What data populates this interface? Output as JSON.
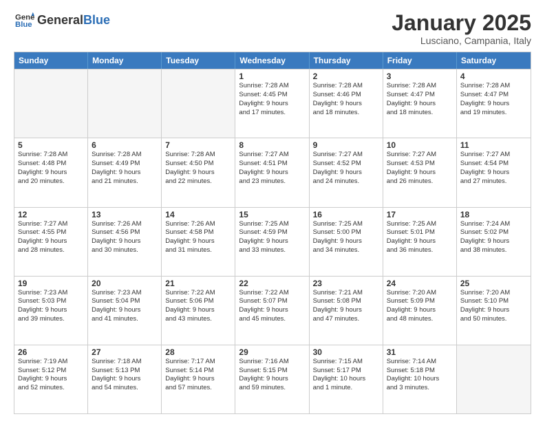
{
  "header": {
    "logo_general": "General",
    "logo_blue": "Blue",
    "month_title": "January 2025",
    "location": "Lusciano, Campania, Italy"
  },
  "weekdays": [
    "Sunday",
    "Monday",
    "Tuesday",
    "Wednesday",
    "Thursday",
    "Friday",
    "Saturday"
  ],
  "weeks": [
    [
      {
        "day": "",
        "info": ""
      },
      {
        "day": "",
        "info": ""
      },
      {
        "day": "",
        "info": ""
      },
      {
        "day": "1",
        "info": "Sunrise: 7:28 AM\nSunset: 4:45 PM\nDaylight: 9 hours\nand 17 minutes."
      },
      {
        "day": "2",
        "info": "Sunrise: 7:28 AM\nSunset: 4:46 PM\nDaylight: 9 hours\nand 18 minutes."
      },
      {
        "day": "3",
        "info": "Sunrise: 7:28 AM\nSunset: 4:47 PM\nDaylight: 9 hours\nand 18 minutes."
      },
      {
        "day": "4",
        "info": "Sunrise: 7:28 AM\nSunset: 4:47 PM\nDaylight: 9 hours\nand 19 minutes."
      }
    ],
    [
      {
        "day": "5",
        "info": "Sunrise: 7:28 AM\nSunset: 4:48 PM\nDaylight: 9 hours\nand 20 minutes."
      },
      {
        "day": "6",
        "info": "Sunrise: 7:28 AM\nSunset: 4:49 PM\nDaylight: 9 hours\nand 21 minutes."
      },
      {
        "day": "7",
        "info": "Sunrise: 7:28 AM\nSunset: 4:50 PM\nDaylight: 9 hours\nand 22 minutes."
      },
      {
        "day": "8",
        "info": "Sunrise: 7:27 AM\nSunset: 4:51 PM\nDaylight: 9 hours\nand 23 minutes."
      },
      {
        "day": "9",
        "info": "Sunrise: 7:27 AM\nSunset: 4:52 PM\nDaylight: 9 hours\nand 24 minutes."
      },
      {
        "day": "10",
        "info": "Sunrise: 7:27 AM\nSunset: 4:53 PM\nDaylight: 9 hours\nand 26 minutes."
      },
      {
        "day": "11",
        "info": "Sunrise: 7:27 AM\nSunset: 4:54 PM\nDaylight: 9 hours\nand 27 minutes."
      }
    ],
    [
      {
        "day": "12",
        "info": "Sunrise: 7:27 AM\nSunset: 4:55 PM\nDaylight: 9 hours\nand 28 minutes."
      },
      {
        "day": "13",
        "info": "Sunrise: 7:26 AM\nSunset: 4:56 PM\nDaylight: 9 hours\nand 30 minutes."
      },
      {
        "day": "14",
        "info": "Sunrise: 7:26 AM\nSunset: 4:58 PM\nDaylight: 9 hours\nand 31 minutes."
      },
      {
        "day": "15",
        "info": "Sunrise: 7:25 AM\nSunset: 4:59 PM\nDaylight: 9 hours\nand 33 minutes."
      },
      {
        "day": "16",
        "info": "Sunrise: 7:25 AM\nSunset: 5:00 PM\nDaylight: 9 hours\nand 34 minutes."
      },
      {
        "day": "17",
        "info": "Sunrise: 7:25 AM\nSunset: 5:01 PM\nDaylight: 9 hours\nand 36 minutes."
      },
      {
        "day": "18",
        "info": "Sunrise: 7:24 AM\nSunset: 5:02 PM\nDaylight: 9 hours\nand 38 minutes."
      }
    ],
    [
      {
        "day": "19",
        "info": "Sunrise: 7:23 AM\nSunset: 5:03 PM\nDaylight: 9 hours\nand 39 minutes."
      },
      {
        "day": "20",
        "info": "Sunrise: 7:23 AM\nSunset: 5:04 PM\nDaylight: 9 hours\nand 41 minutes."
      },
      {
        "day": "21",
        "info": "Sunrise: 7:22 AM\nSunset: 5:06 PM\nDaylight: 9 hours\nand 43 minutes."
      },
      {
        "day": "22",
        "info": "Sunrise: 7:22 AM\nSunset: 5:07 PM\nDaylight: 9 hours\nand 45 minutes."
      },
      {
        "day": "23",
        "info": "Sunrise: 7:21 AM\nSunset: 5:08 PM\nDaylight: 9 hours\nand 47 minutes."
      },
      {
        "day": "24",
        "info": "Sunrise: 7:20 AM\nSunset: 5:09 PM\nDaylight: 9 hours\nand 48 minutes."
      },
      {
        "day": "25",
        "info": "Sunrise: 7:20 AM\nSunset: 5:10 PM\nDaylight: 9 hours\nand 50 minutes."
      }
    ],
    [
      {
        "day": "26",
        "info": "Sunrise: 7:19 AM\nSunset: 5:12 PM\nDaylight: 9 hours\nand 52 minutes."
      },
      {
        "day": "27",
        "info": "Sunrise: 7:18 AM\nSunset: 5:13 PM\nDaylight: 9 hours\nand 54 minutes."
      },
      {
        "day": "28",
        "info": "Sunrise: 7:17 AM\nSunset: 5:14 PM\nDaylight: 9 hours\nand 57 minutes."
      },
      {
        "day": "29",
        "info": "Sunrise: 7:16 AM\nSunset: 5:15 PM\nDaylight: 9 hours\nand 59 minutes."
      },
      {
        "day": "30",
        "info": "Sunrise: 7:15 AM\nSunset: 5:17 PM\nDaylight: 10 hours\nand 1 minute."
      },
      {
        "day": "31",
        "info": "Sunrise: 7:14 AM\nSunset: 5:18 PM\nDaylight: 10 hours\nand 3 minutes."
      },
      {
        "day": "",
        "info": ""
      }
    ]
  ]
}
